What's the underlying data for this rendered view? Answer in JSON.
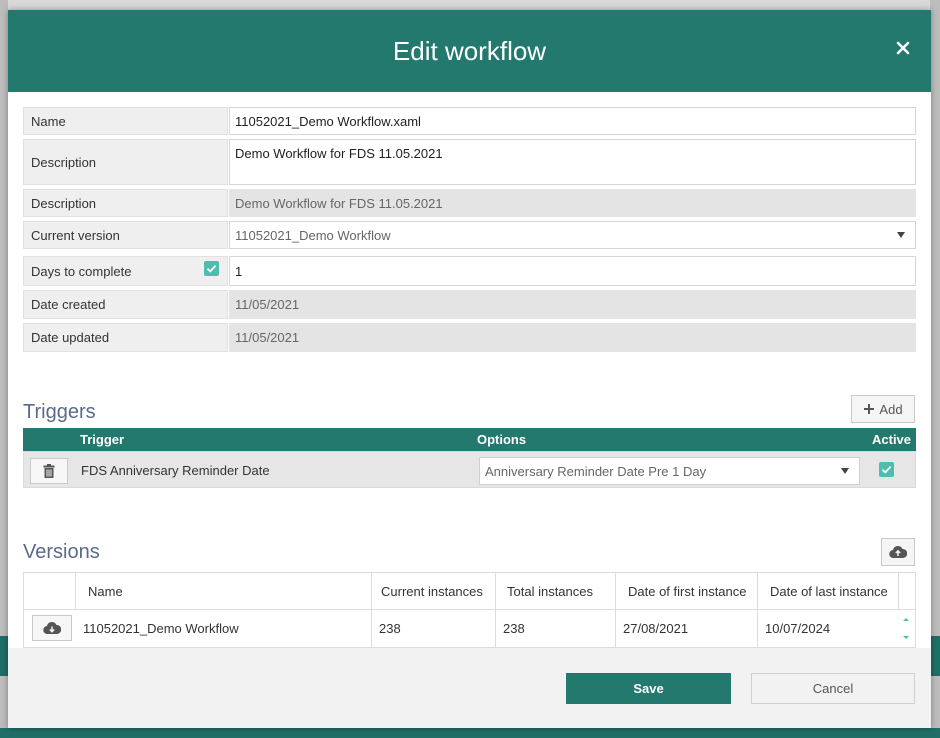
{
  "dialog": {
    "title": "Edit workflow"
  },
  "fields": {
    "name": {
      "label": "Name",
      "value": "11052021_Demo Workflow.xaml"
    },
    "description_edit": {
      "label": "Description",
      "value": "Demo Workflow for FDS 11.05.2021"
    },
    "description_read": {
      "label": "Description",
      "value": "Demo Workflow for FDS 11.05.2021"
    },
    "current_version": {
      "label": "Current version",
      "value": "11052021_Demo Workflow"
    },
    "days_to_complete": {
      "label": "Days to complete",
      "value": "1",
      "checked": true
    },
    "date_created": {
      "label": "Date created",
      "value": "11/05/2021"
    },
    "date_updated": {
      "label": "Date updated",
      "value": "11/05/2021"
    }
  },
  "triggers": {
    "title": "Triggers",
    "add_label": "Add",
    "columns": {
      "trigger": "Trigger",
      "options": "Options",
      "active": "Active"
    },
    "rows": [
      {
        "name": "FDS Anniversary Reminder Date",
        "option": "Anniversary Reminder Date Pre 1 Day",
        "active": true
      }
    ]
  },
  "versions": {
    "title": "Versions",
    "columns": {
      "name": "Name",
      "current_instances": "Current instances",
      "total_instances": "Total instances",
      "date_first": "Date of first instance",
      "date_last": "Date of last instance"
    },
    "rows": [
      {
        "name": "11052021_Demo Workflow",
        "current_instances": "238",
        "total_instances": "238",
        "date_first": "27/08/2021",
        "date_last": "10/07/2024"
      }
    ]
  },
  "footer": {
    "save_label": "Save",
    "cancel_label": "Cancel"
  },
  "colors": {
    "primary": "#23796e",
    "checkbox": "#4fbcb0",
    "section_title": "#5b6a8a"
  }
}
